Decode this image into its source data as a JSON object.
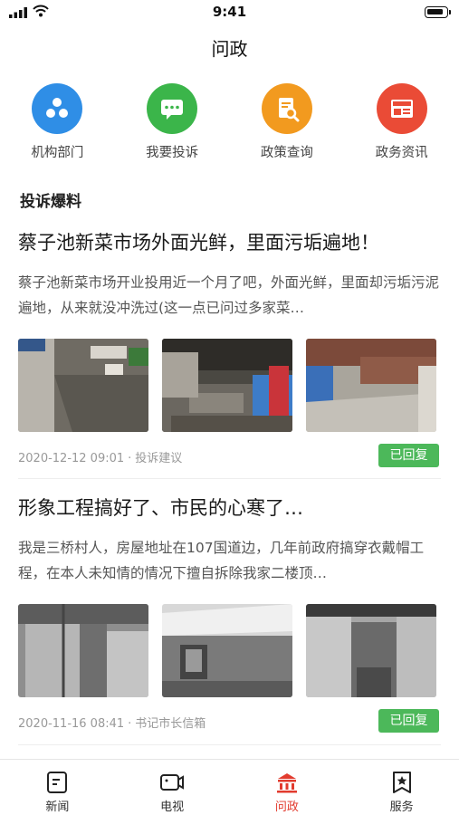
{
  "status_bar": {
    "time": "9:41"
  },
  "header": {
    "title": "问政"
  },
  "quick_nav": [
    {
      "label": "机构部门",
      "icon": "organization-icon",
      "color": "#2f8ee6"
    },
    {
      "label": "我要投诉",
      "icon": "complaint-chat-icon",
      "color": "#3bb54a"
    },
    {
      "label": "政策查询",
      "icon": "policy-search-icon",
      "color": "#f29a1f"
    },
    {
      "label": "政务资讯",
      "icon": "news-icon",
      "color": "#ea4b36"
    }
  ],
  "section": {
    "title": "投诉爆料"
  },
  "posts": [
    {
      "title": "蔡子池新菜市场外面光鲜，里面污垢遍地！",
      "body": "蔡子池新菜市场开业投用近一个月了吧，外面光鲜，里面却污垢污泥遍地，从来就没冲洗过(这一点已问过多家菜…",
      "date": "2020-12-12 09:01",
      "separator": "·",
      "category": "投诉建议",
      "status": "已回复"
    },
    {
      "title": "形象工程搞好了、市民的心寒了…",
      "body": "我是三桥村人，房屋地址在107国道边，几年前政府搞穿衣戴帽工程，在本人未知情的情况下擅自拆除我家二楼顶…",
      "date": "2020-11-16 08:41",
      "separator": "·",
      "category": "书记市长信箱",
      "status": "已回复"
    }
  ],
  "tabs": [
    {
      "label": "新闻",
      "icon": "news-tab-icon",
      "active": false
    },
    {
      "label": "电视",
      "icon": "tv-tab-icon",
      "active": false
    },
    {
      "label": "问政",
      "icon": "government-tab-icon",
      "active": true
    },
    {
      "label": "服务",
      "icon": "service-tab-icon",
      "active": false
    }
  ],
  "colors": {
    "accent": "#e23b2e",
    "badge": "#4cb85a"
  }
}
